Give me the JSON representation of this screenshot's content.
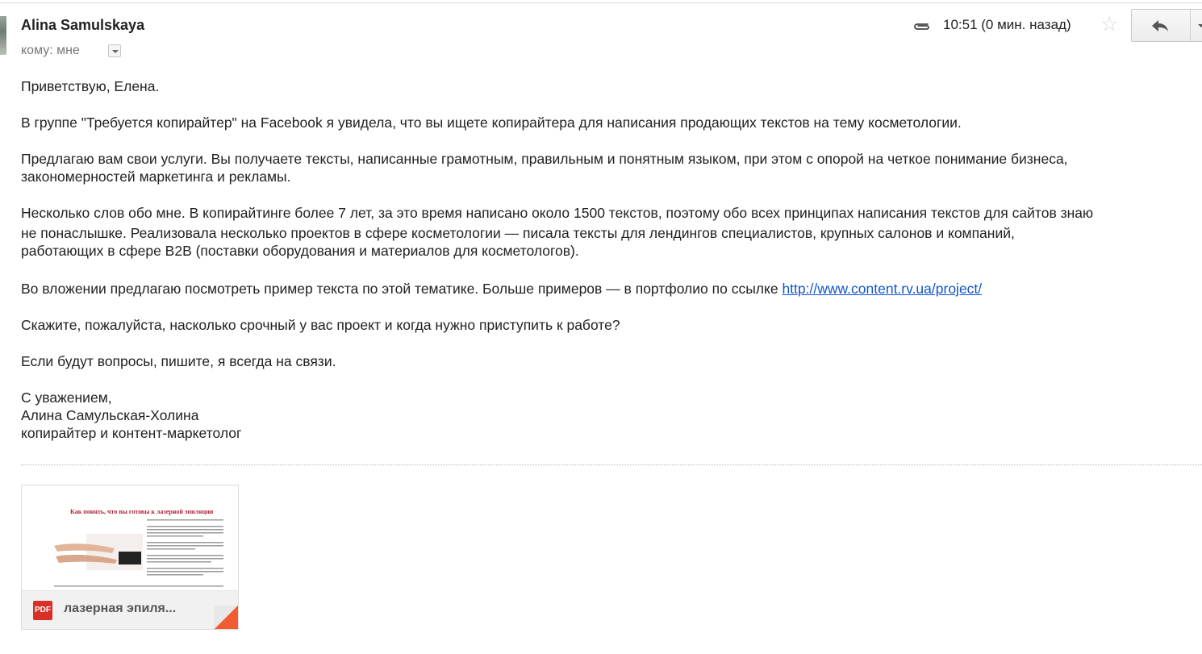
{
  "header": {
    "sender": "Alina Samulskaya",
    "to_label": "кому: мне",
    "time": "10:51 (0 мин. назад)"
  },
  "body": {
    "greeting": "Приветствую, Елена.",
    "p1": "В группе \"Требуется копирайтер\" на Facebook я увидела, что вы ищете копирайтера для написания продающих текстов на тему косметологии.",
    "p2_line1": "Предлагаю вам свои услуги. Вы получаете тексты, написанные грамотным, правильным и понятным языком, при этом с опорой на четкое понимание бизнеса,",
    "p2_line2": "закономерностей маркетинга и рекламы.",
    "p3_line1": "Несколько слов обо мне. В копирайтинге более 7 лет, за это время написано около 1500 текстов, поэтому обо всех принципах написания текстов для сайтов знаю",
    "p3_line2": "не понаслышке. Реализовала несколько проектов в сфере косметологии — писала тексты для лендингов специалистов, крупных салонов и компаний,",
    "p3_line3": "работающих в сфере B2B (поставки оборудования и материалов для косметологов).",
    "p4_text": "Во вложении предлагаю посмотреть пример текста по этой тематике. Больше примеров — в портфолио по ссылке ",
    "p4_link": "http://www.content.rv.ua/project/",
    "p5": "Скажите, пожалуйста, насколько срочный у вас проект и когда нужно приступить к работе?",
    "p6": "Если будут вопросы, пишите, я всегда на связи.",
    "sig_line1": "С уважением,",
    "sig_line2": "Алина Самульская-Холина",
    "sig_line3": "копирайтер и контент-маркетолог"
  },
  "attachment": {
    "type_label": "PDF",
    "name": "лазерная эпиля...",
    "preview_title": "Как понять, что вы готовы к лазерной эпиляции"
  },
  "icons": {
    "attachment": "paperclip-icon",
    "star": "star-icon",
    "reply": "reply-arrow-icon",
    "more": "chevron-down-icon"
  },
  "colors": {
    "link": "#1155cc",
    "pdf": "#d93025",
    "preview_title": "#b0243a"
  }
}
